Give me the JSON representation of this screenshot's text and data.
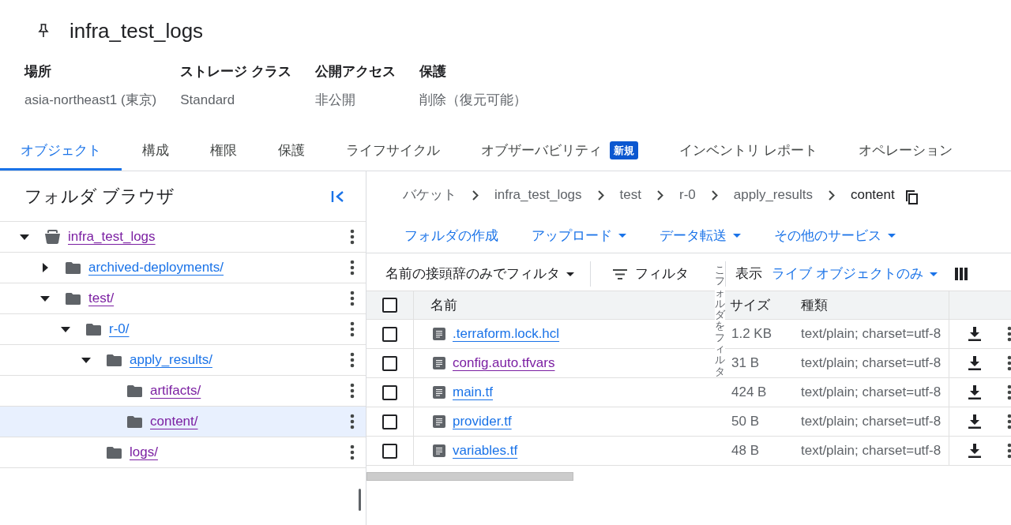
{
  "bucket": {
    "title": "infra_test_logs",
    "pinned": true
  },
  "meta": [
    {
      "label": "場所",
      "value": "asia-northeast1 (東京)"
    },
    {
      "label": "ストレージ クラス",
      "value": "Standard"
    },
    {
      "label": "公開アクセス",
      "value": "非公開"
    },
    {
      "label": "保護",
      "value": "削除（復元可能）"
    }
  ],
  "tabs": [
    {
      "label": "オブジェクト",
      "selected": true
    },
    {
      "label": "構成",
      "selected": false
    },
    {
      "label": "権限",
      "selected": false
    },
    {
      "label": "保護",
      "selected": false
    },
    {
      "label": "ライフサイクル",
      "selected": false
    },
    {
      "label": "オブザーバビリティ",
      "selected": false,
      "badge": "新規"
    },
    {
      "label": "インベントリ レポート",
      "selected": false
    },
    {
      "label": "オペレーション",
      "selected": false
    }
  ],
  "folder_browser": {
    "title": "フォルダ ブラウザ",
    "items": [
      {
        "label": "infra_test_logs",
        "kind": "bucket",
        "expanded": true,
        "visited": true,
        "selected": false,
        "children": [
          {
            "label": "archived-deployments/",
            "kind": "folder",
            "expanded": false,
            "visited": false,
            "selected": false
          },
          {
            "label": "test/",
            "kind": "folder",
            "expanded": true,
            "visited": true,
            "selected": false,
            "children": [
              {
                "label": "r-0/",
                "kind": "folder",
                "expanded": true,
                "visited": false,
                "selected": false,
                "children": [
                  {
                    "label": "apply_results/",
                    "kind": "folder",
                    "expanded": true,
                    "visited": false,
                    "selected": false,
                    "children": [
                      {
                        "label": "artifacts/",
                        "kind": "folder",
                        "visited": true,
                        "selected": false
                      },
                      {
                        "label": "content/",
                        "kind": "folder",
                        "visited": true,
                        "selected": true
                      }
                    ]
                  },
                  {
                    "label": "logs/",
                    "kind": "folder",
                    "visited": true,
                    "selected": false
                  }
                ]
              }
            ]
          }
        ]
      }
    ]
  },
  "breadcrumbs": [
    {
      "label": "バケット",
      "current": false
    },
    {
      "label": "infra_test_logs",
      "current": false
    },
    {
      "label": "test",
      "current": false
    },
    {
      "label": "r-0",
      "current": false
    },
    {
      "label": "apply_results",
      "current": false
    },
    {
      "label": "content",
      "current": true
    }
  ],
  "actions": [
    {
      "label": "フォルダの作成",
      "has_menu": false
    },
    {
      "label": "アップロード",
      "has_menu": true
    },
    {
      "label": "データ転送",
      "has_menu": true
    },
    {
      "label": "その他のサービス",
      "has_menu": true
    }
  ],
  "toolbar": {
    "prefix_filter": "名前の接頭辞のみでフィルタ",
    "filter": "フィルタ",
    "overflow_text": "こフォルダをフィルタ",
    "view_label": "表示",
    "view_value": "ライブ オブジェクトのみ"
  },
  "table": {
    "select_all_checked": false,
    "columns": [
      "名前",
      "サイズ",
      "種類"
    ],
    "rows": [
      {
        "name": ".terraform.lock.hcl",
        "size": "1.2 KB",
        "type": "text/plain; charset=utf-8",
        "visited": false,
        "checked": false
      },
      {
        "name": "config.auto.tfvars",
        "size": "31 B",
        "type": "text/plain; charset=utf-8",
        "visited": true,
        "checked": false
      },
      {
        "name": "main.tf",
        "size": "424 B",
        "type": "text/plain; charset=utf-8",
        "visited": false,
        "checked": false
      },
      {
        "name": "provider.tf",
        "size": "50 B",
        "type": "text/plain; charset=utf-8",
        "visited": false,
        "checked": false
      },
      {
        "name": "variables.tf",
        "size": "48 B",
        "type": "text/plain; charset=utf-8",
        "visited": false,
        "checked": false
      }
    ]
  }
}
